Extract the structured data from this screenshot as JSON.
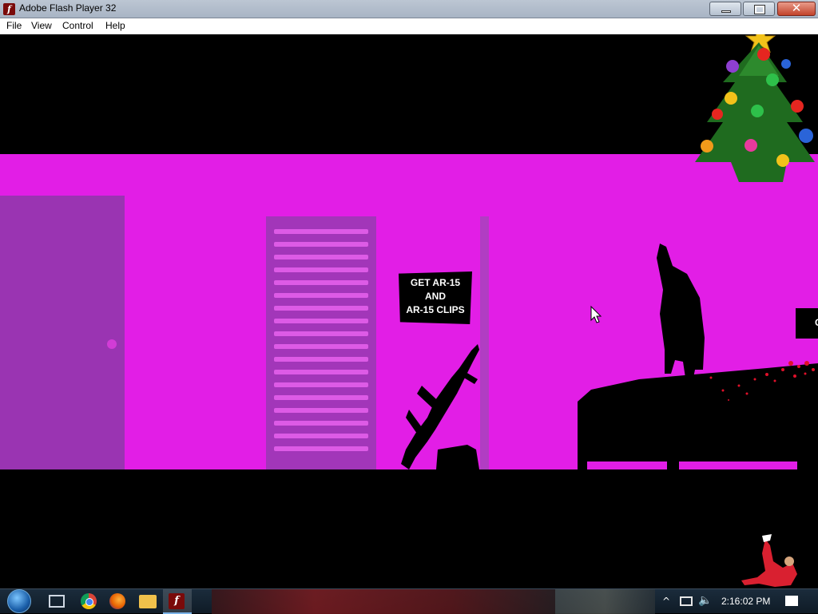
{
  "window": {
    "title": "Adobe Flash Player 32",
    "icon": "flash-icon",
    "close_label": "✕"
  },
  "menu": {
    "items": [
      "File",
      "View",
      "Control",
      "Help"
    ]
  },
  "game": {
    "sign_lines": [
      "GET AR-15",
      "AND",
      "AR-15 CLIPS"
    ],
    "right_sign_text": "C",
    "colors": {
      "wall": "#e21ee6",
      "door": "#9a34b2",
      "shutter": "#a236b9",
      "silhouette": "#000000",
      "blood": "#e0102a"
    }
  },
  "decorations": {
    "top_right": "christmas-tree-icon",
    "bottom_right": "skater-figure"
  },
  "taskbar": {
    "pinned": [
      "start-orb",
      "task-view-icon",
      "chrome-icon",
      "firefox-icon",
      "file-explorer-icon",
      "flash-player-icon"
    ],
    "clock": "2:16:02 PM"
  }
}
